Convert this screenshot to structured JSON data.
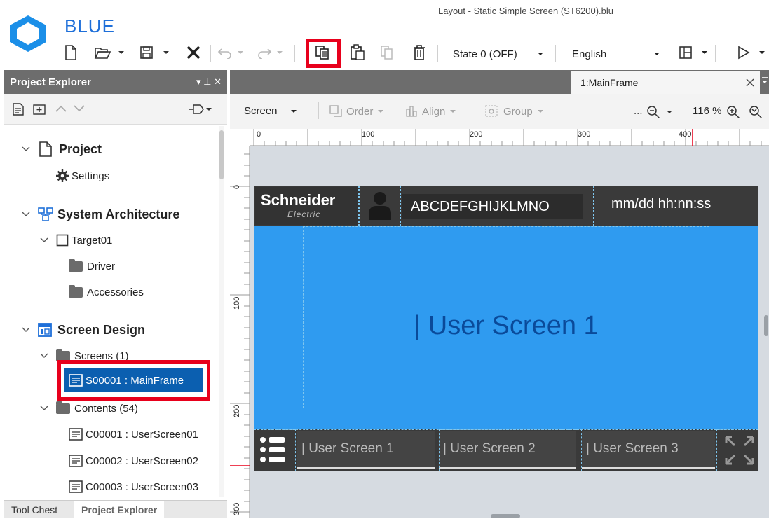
{
  "app": {
    "name": "BLUE",
    "window_title": "Layout - Static Simple Screen (ST6200).blu"
  },
  "ribbon": {
    "state_select": "State 0 (OFF)",
    "language_select": "English",
    "icons": [
      "new-file-icon",
      "open-folder-icon",
      "save-icon",
      "close-icon",
      "undo-icon",
      "redo-icon",
      "copy-icon",
      "paste-icon",
      "duplicate-icon",
      "delete-icon",
      "layout-icon",
      "play-icon"
    ]
  },
  "project_explorer": {
    "title": "Project Explorer",
    "header_controls": "▾ ⊥ ✕",
    "tree": {
      "project": "Project",
      "settings": "Settings",
      "system_architecture": "System Architecture",
      "target": "Target01",
      "driver": "Driver",
      "accessories": "Accessories",
      "screen_design": "Screen Design",
      "screens": "Screens (1)",
      "mainframe": "S00001 : MainFrame",
      "contents": "Contents (54)",
      "content_items": [
        "C00001 : UserScreen01",
        "C00002 : UserScreen02",
        "C00003 : UserScreen03"
      ]
    },
    "bottom_tabs": [
      "Tool Chest",
      "Project Explorer"
    ]
  },
  "document": {
    "tab_label": "1:MainFrame",
    "toolbar": {
      "screen_select": "Screen",
      "order": "Order",
      "align": "Align",
      "group": "Group",
      "more": "...",
      "zoom": "116 %"
    },
    "ruler_top_labels": [
      "0",
      "100",
      "200",
      "300",
      "400"
    ],
    "ruler_left_labels": [
      "0",
      "100",
      "200",
      "300"
    ]
  },
  "hmi_screen": {
    "logo_line1": "Schneider",
    "logo_line2": "Electric",
    "user_field": "ABCDEFGHIJKLMNO",
    "datetime": "mm/dd hh:nn:ss",
    "main_text": "| User Screen 1",
    "footer_buttons": [
      "| User Screen 1",
      "| User Screen 2",
      "| User Screen 3"
    ]
  },
  "colors": {
    "accent": "#1e6fd9",
    "panel_header": "#6d6d6d",
    "selection": "#0b5fb0",
    "highlight": "#e8001c",
    "hmi_blue": "#2f9bf0",
    "hmi_dark": "#3a3a3a"
  }
}
